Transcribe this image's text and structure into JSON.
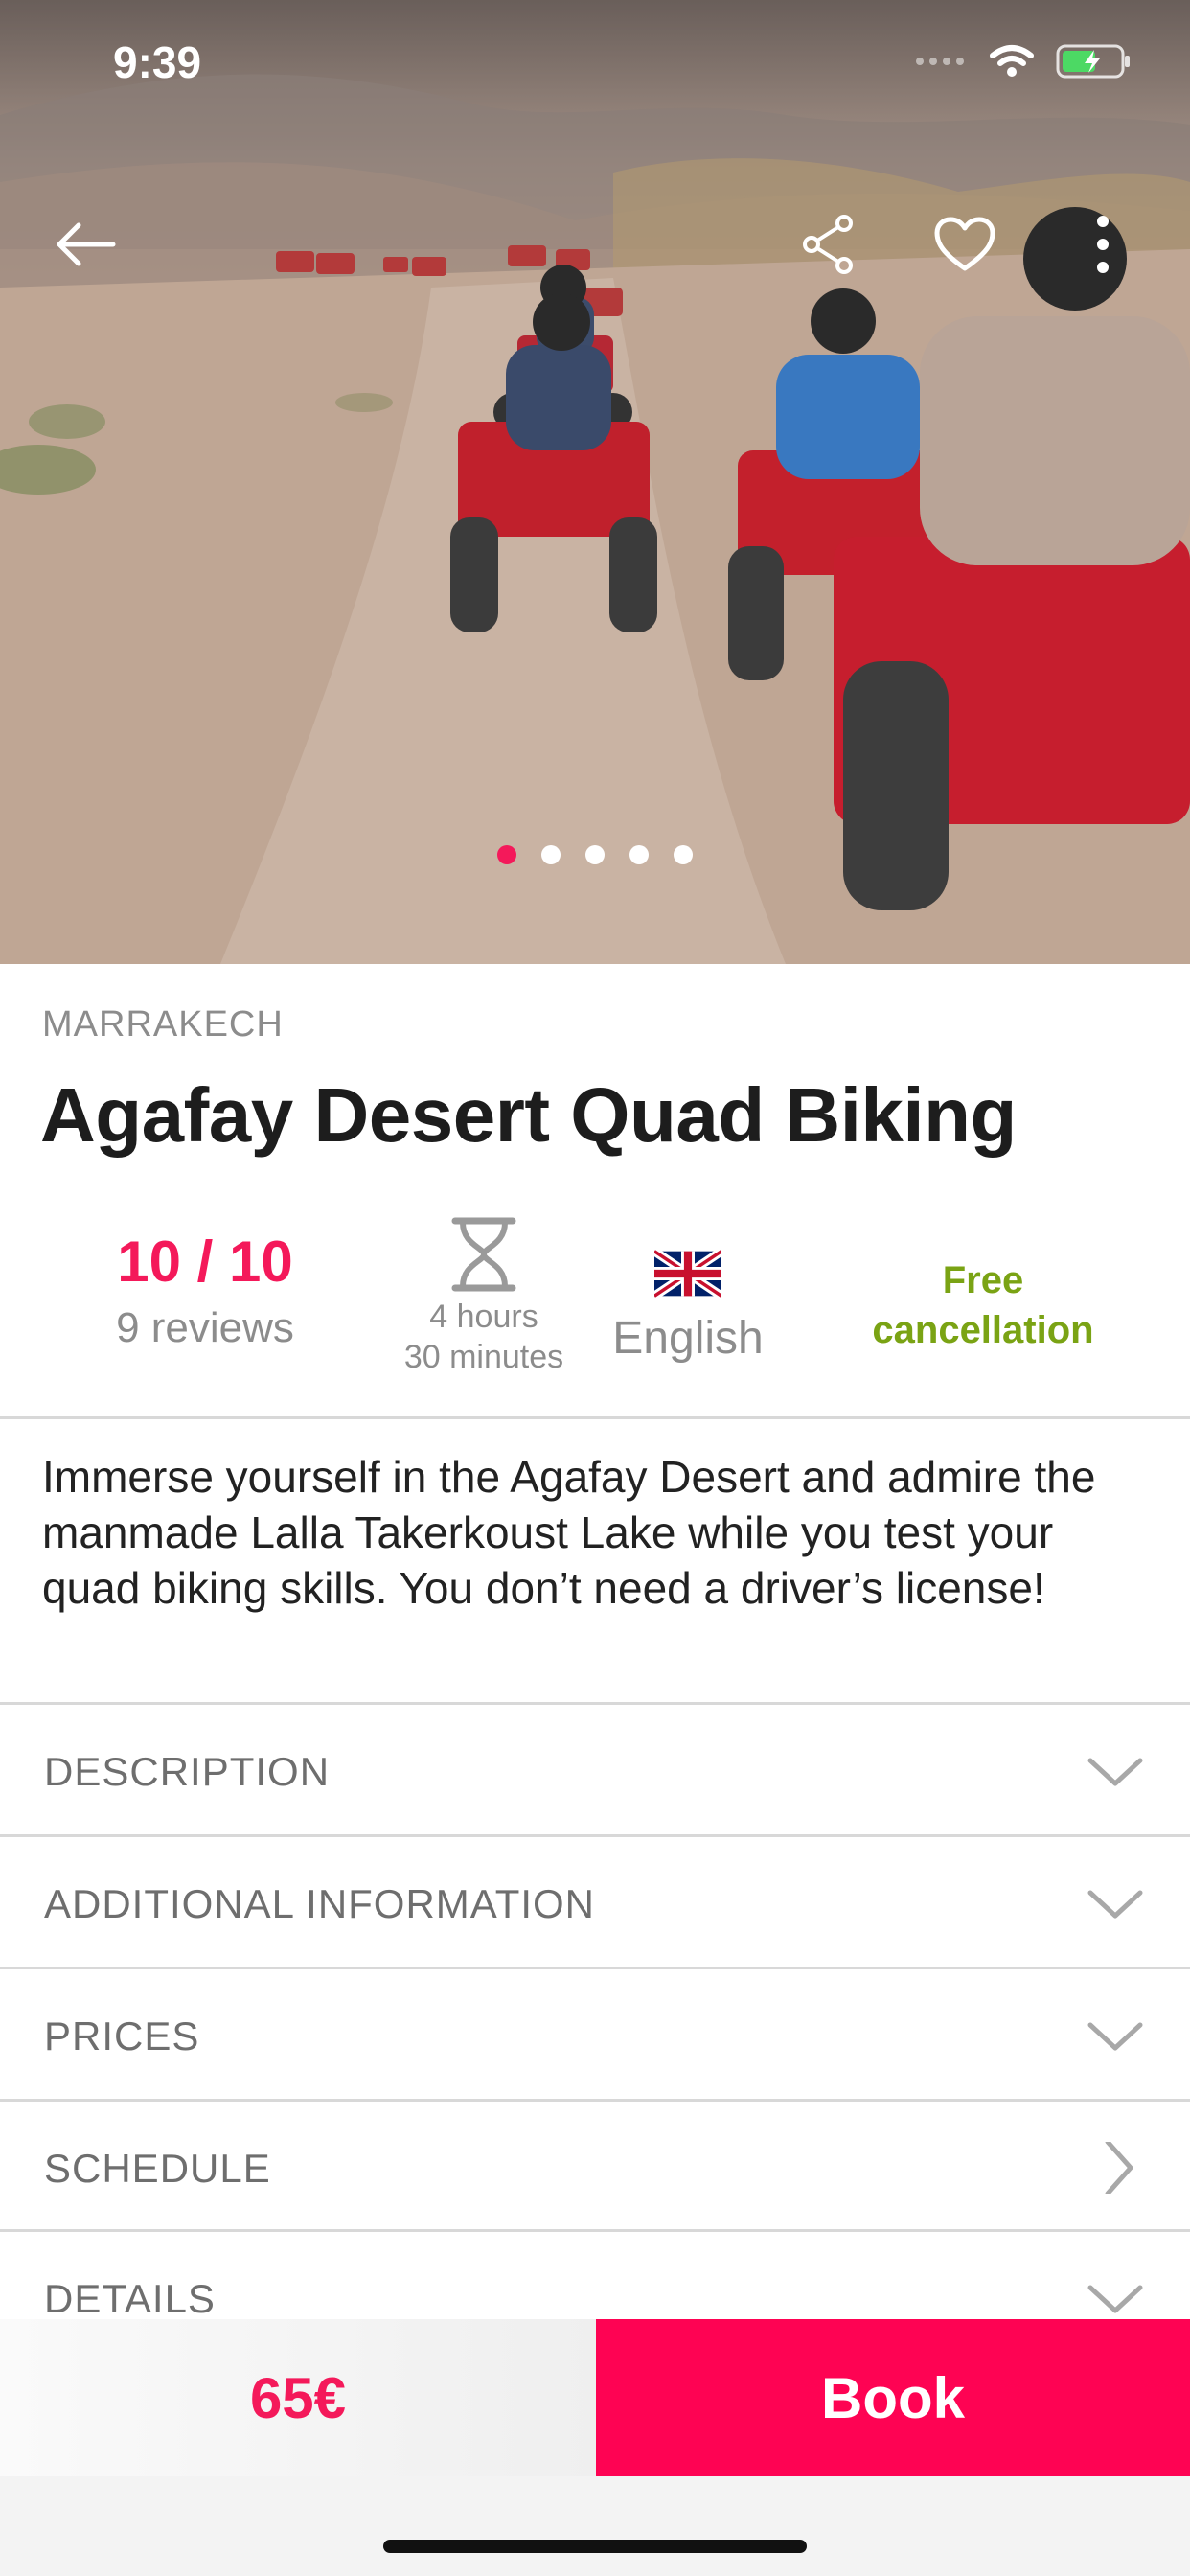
{
  "status_bar": {
    "time": "9:39"
  },
  "gallery": {
    "slide_count": 5,
    "active_index": 0
  },
  "activity": {
    "city": "MARRAKECH",
    "title": "Agafay Desert Quad Biking",
    "rating": "10 / 10",
    "reviews": "9 reviews",
    "duration_line1": "4 hours",
    "duration_line2": "30 minutes",
    "language": "English",
    "cancellation_line1": "Free",
    "cancellation_line2": "cancellation",
    "summary": "Immerse yourself in the Agafay Desert and admire the manmade Lalla Takerkoust Lake while you test your quad biking skills. You don’t need a driver’s license!"
  },
  "sections": [
    {
      "label": "DESCRIPTION",
      "icon": "chevron-down-icon"
    },
    {
      "label": "ADDITIONAL INFORMATION",
      "icon": "chevron-down-icon"
    },
    {
      "label": "PRICES",
      "icon": "chevron-down-icon"
    },
    {
      "label": "SCHEDULE",
      "icon": "chevron-right-icon"
    },
    {
      "label": "DETAILS",
      "icon": "chevron-down-icon"
    }
  ],
  "booking": {
    "price": "65€",
    "book_label": "Book"
  },
  "colors": {
    "accent": "#f4195a",
    "book_button": "#fe0353",
    "free_cancellation": "#7aa314"
  }
}
